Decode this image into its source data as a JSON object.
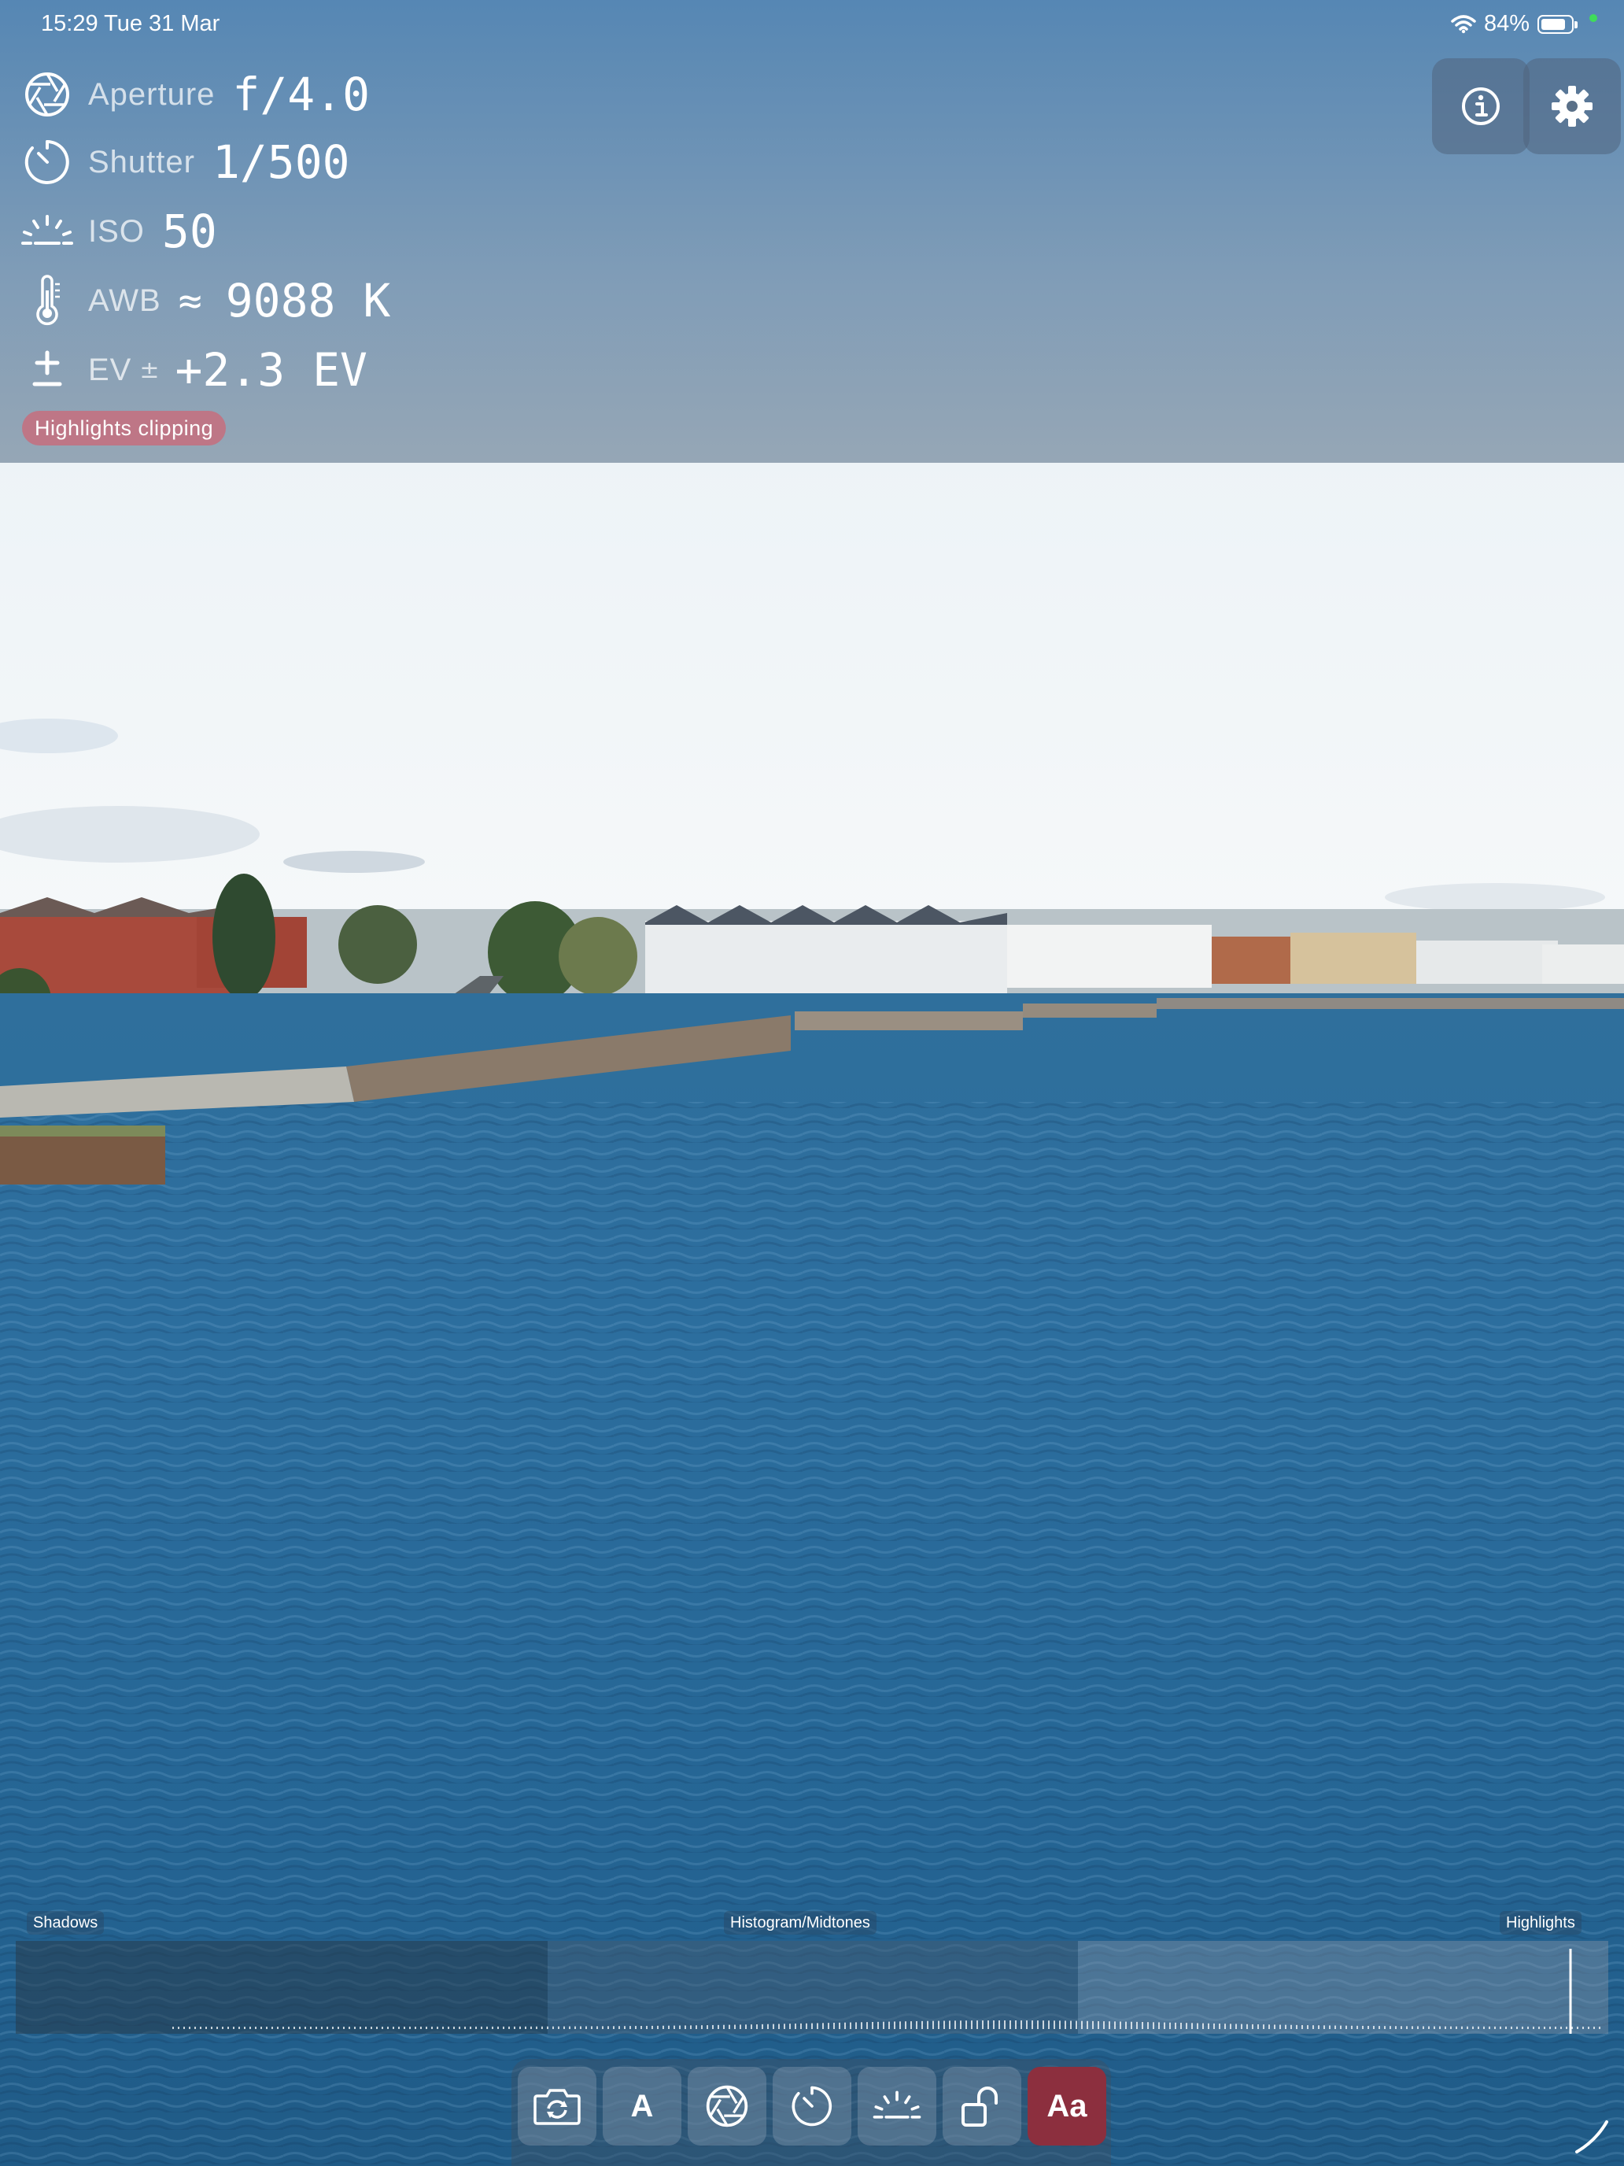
{
  "status_bar": {
    "time_date": "15:29  Tue 31 Mar",
    "battery": "84%",
    "battery_level": 0.84
  },
  "readouts": {
    "aperture": {
      "label": "Aperture",
      "value": "f/4.0"
    },
    "shutter": {
      "label": "Shutter",
      "value": "1/500"
    },
    "iso": {
      "label": "ISO",
      "value": "50"
    },
    "white_balance": {
      "label": "AWB",
      "approx": "≈",
      "value": "9088 K"
    },
    "ev": {
      "label": "EV",
      "pm": "±",
      "value": "+2.3 EV"
    }
  },
  "badge": {
    "text": "Highlights clipping"
  },
  "buttons": {
    "info": "info-icon",
    "settings": "gear-icon"
  },
  "histogram": {
    "shadows_label": "Shadows",
    "midtones_label": "Histogram/Midtones",
    "highlights_label": "Highlights"
  },
  "toolbar": {
    "items": [
      {
        "name": "switch-camera",
        "icon": "camera-rotate-icon"
      },
      {
        "name": "auto-mode",
        "text": "A"
      },
      {
        "name": "aperture",
        "icon": "aperture-icon"
      },
      {
        "name": "shutter",
        "icon": "timer-icon"
      },
      {
        "name": "iso",
        "icon": "sun-horizon-icon"
      },
      {
        "name": "lock",
        "icon": "unlocked-icon"
      },
      {
        "name": "text-size",
        "text": "Aa",
        "active": true
      }
    ]
  },
  "colors": {
    "active_tool": "#8c2f3e",
    "clip_badge": "#c47080",
    "water": "#2a6c9c"
  }
}
